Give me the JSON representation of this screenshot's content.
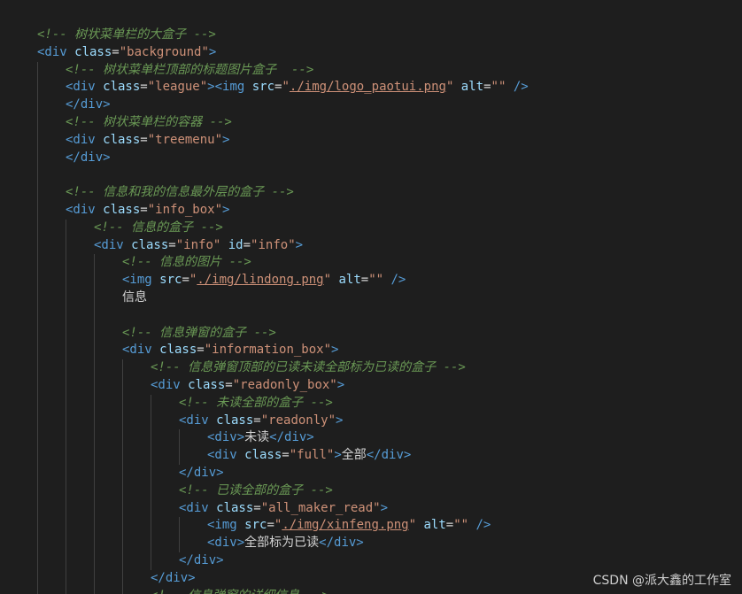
{
  "code_lines": [
    [
      {
        "t": "<!-- 树状菜单栏的大盒子 -->",
        "c": "cmt"
      }
    ],
    [
      {
        "t": "<div",
        "c": "tag"
      },
      {
        "t": " class",
        "c": "attr"
      },
      {
        "t": "=",
        "c": "txt"
      },
      {
        "t": "\"background\"",
        "c": "str"
      },
      {
        "t": ">",
        "c": "tag"
      }
    ],
    [
      {
        "t": "<!-- 树状菜单栏顶部的标题图片盒子  -->",
        "c": "cmt"
      }
    ],
    [
      {
        "t": "<div",
        "c": "tag"
      },
      {
        "t": " class",
        "c": "attr"
      },
      {
        "t": "=",
        "c": "txt"
      },
      {
        "t": "\"league\"",
        "c": "str"
      },
      {
        "t": "><img",
        "c": "tag"
      },
      {
        "t": " src",
        "c": "attr"
      },
      {
        "t": "=",
        "c": "txt"
      },
      {
        "t": "\"",
        "c": "str"
      },
      {
        "t": "./img/logo_paotui.png",
        "c": "str link"
      },
      {
        "t": "\"",
        "c": "str"
      },
      {
        "t": " alt",
        "c": "attr"
      },
      {
        "t": "=",
        "c": "txt"
      },
      {
        "t": "\"\"",
        "c": "str"
      },
      {
        "t": " />",
        "c": "tag"
      }
    ],
    [
      {
        "t": "</div>",
        "c": "tag"
      }
    ],
    [
      {
        "t": "<!-- 树状菜单栏的容器 -->",
        "c": "cmt"
      }
    ],
    [
      {
        "t": "<div",
        "c": "tag"
      },
      {
        "t": " class",
        "c": "attr"
      },
      {
        "t": "=",
        "c": "txt"
      },
      {
        "t": "\"treemenu\"",
        "c": "str"
      },
      {
        "t": ">",
        "c": "tag"
      }
    ],
    [
      {
        "t": "</div>",
        "c": "tag"
      }
    ],
    [],
    [
      {
        "t": "<!-- 信息和我的信息最外层的盒子 -->",
        "c": "cmt"
      }
    ],
    [
      {
        "t": "<div",
        "c": "tag"
      },
      {
        "t": " class",
        "c": "attr"
      },
      {
        "t": "=",
        "c": "txt"
      },
      {
        "t": "\"info_box\"",
        "c": "str"
      },
      {
        "t": ">",
        "c": "tag"
      }
    ],
    [
      {
        "t": "<!-- 信息的盒子 -->",
        "c": "cmt"
      }
    ],
    [
      {
        "t": "<div",
        "c": "tag"
      },
      {
        "t": " class",
        "c": "attr"
      },
      {
        "t": "=",
        "c": "txt"
      },
      {
        "t": "\"info\"",
        "c": "str"
      },
      {
        "t": " id",
        "c": "attr"
      },
      {
        "t": "=",
        "c": "txt"
      },
      {
        "t": "\"info\"",
        "c": "str"
      },
      {
        "t": ">",
        "c": "tag"
      }
    ],
    [
      {
        "t": "<!-- 信息的图片 -->",
        "c": "cmt"
      }
    ],
    [
      {
        "t": "<img",
        "c": "tag"
      },
      {
        "t": " src",
        "c": "attr"
      },
      {
        "t": "=",
        "c": "txt"
      },
      {
        "t": "\"",
        "c": "str"
      },
      {
        "t": "./img/lindong.png",
        "c": "str link"
      },
      {
        "t": "\"",
        "c": "str"
      },
      {
        "t": " alt",
        "c": "attr"
      },
      {
        "t": "=",
        "c": "txt"
      },
      {
        "t": "\"\"",
        "c": "str"
      },
      {
        "t": " />",
        "c": "tag"
      }
    ],
    [
      {
        "t": "信息",
        "c": "txt"
      }
    ],
    [],
    [
      {
        "t": "<!-- 信息弹窗的盒子 -->",
        "c": "cmt"
      }
    ],
    [
      {
        "t": "<div",
        "c": "tag"
      },
      {
        "t": " class",
        "c": "attr"
      },
      {
        "t": "=",
        "c": "txt"
      },
      {
        "t": "\"information_box\"",
        "c": "str"
      },
      {
        "t": ">",
        "c": "tag"
      }
    ],
    [
      {
        "t": "<!-- 信息弹窗顶部的已读未读全部标为已读的盒子 -->",
        "c": "cmt"
      }
    ],
    [
      {
        "t": "<div",
        "c": "tag"
      },
      {
        "t": " class",
        "c": "attr"
      },
      {
        "t": "=",
        "c": "txt"
      },
      {
        "t": "\"readonly_box\"",
        "c": "str"
      },
      {
        "t": ">",
        "c": "tag"
      }
    ],
    [
      {
        "t": "<!-- 未读全部的盒子 -->",
        "c": "cmt"
      }
    ],
    [
      {
        "t": "<div",
        "c": "tag"
      },
      {
        "t": " class",
        "c": "attr"
      },
      {
        "t": "=",
        "c": "txt"
      },
      {
        "t": "\"readonly\"",
        "c": "str"
      },
      {
        "t": ">",
        "c": "tag"
      }
    ],
    [
      {
        "t": "<div>",
        "c": "tag"
      },
      {
        "t": "未读",
        "c": "txt"
      },
      {
        "t": "</div>",
        "c": "tag"
      }
    ],
    [
      {
        "t": "<div",
        "c": "tag"
      },
      {
        "t": " class",
        "c": "attr"
      },
      {
        "t": "=",
        "c": "txt"
      },
      {
        "t": "\"full\"",
        "c": "str"
      },
      {
        "t": ">",
        "c": "tag"
      },
      {
        "t": "全部",
        "c": "txt"
      },
      {
        "t": "</div>",
        "c": "tag"
      }
    ],
    [
      {
        "t": "</div>",
        "c": "tag"
      }
    ],
    [
      {
        "t": "<!-- 已读全部的盒子 -->",
        "c": "cmt"
      }
    ],
    [
      {
        "t": "<div",
        "c": "tag"
      },
      {
        "t": " class",
        "c": "attr"
      },
      {
        "t": "=",
        "c": "txt"
      },
      {
        "t": "\"all_maker_read\"",
        "c": "str"
      },
      {
        "t": ">",
        "c": "tag"
      }
    ],
    [
      {
        "t": "<img",
        "c": "tag"
      },
      {
        "t": " src",
        "c": "attr"
      },
      {
        "t": "=",
        "c": "txt"
      },
      {
        "t": "\"",
        "c": "str"
      },
      {
        "t": "./img/xinfeng.png",
        "c": "str link"
      },
      {
        "t": "\"",
        "c": "str"
      },
      {
        "t": " alt",
        "c": "attr"
      },
      {
        "t": "=",
        "c": "txt"
      },
      {
        "t": "\"\"",
        "c": "str"
      },
      {
        "t": " />",
        "c": "tag"
      }
    ],
    [
      {
        "t": "<div>",
        "c": "tag"
      },
      {
        "t": "全部标为已读",
        "c": "txt"
      },
      {
        "t": "</div>",
        "c": "tag"
      }
    ],
    [
      {
        "t": "</div>",
        "c": "tag"
      }
    ],
    [
      {
        "t": "</div>",
        "c": "tag"
      }
    ],
    [
      {
        "t": "<!-- 信息弹窗的详细信息 -->",
        "c": "cmt"
      }
    ]
  ],
  "watermark": "CSDN @派大鑫的工作室",
  "colors": {
    "background": "#1e1e1e",
    "comment": "#6a9955",
    "tag": "#569cd6",
    "attribute": "#9cdcfe",
    "string": "#ce9178",
    "text": "#d4d4d4"
  }
}
